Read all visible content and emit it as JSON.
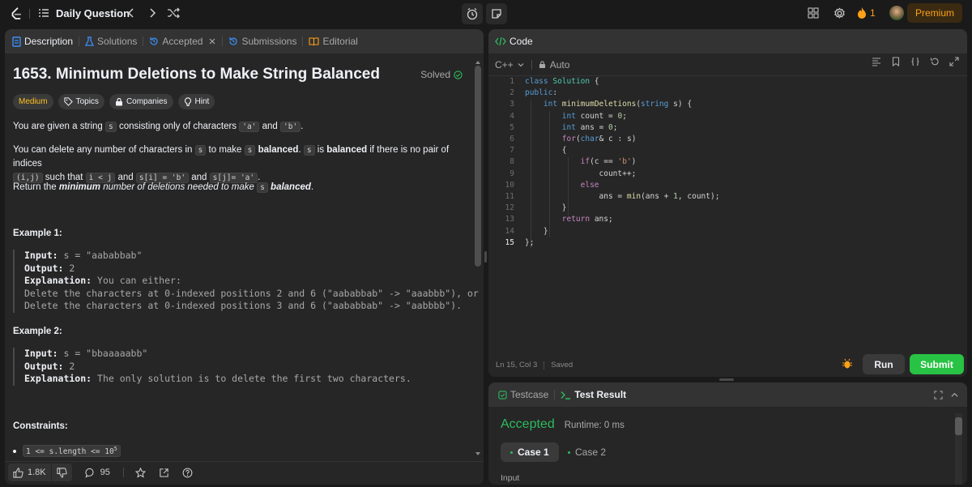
{
  "nav": {
    "title": "Daily Question",
    "streak": "1",
    "premium": "Premium"
  },
  "left_tabs": [
    "Description",
    "Solutions",
    "Accepted",
    "Submissions",
    "Editorial"
  ],
  "problem": {
    "title": "1653. Minimum Deletions to Make String Balanced",
    "status": "Solved",
    "difficulty": "Medium",
    "tags": [
      "Topics",
      "Companies",
      "Hint"
    ],
    "p1": {
      "a": "You are given a string ",
      "c1": "s",
      "b": " consisting only of characters ",
      "c2": "'a'",
      "d": " and ",
      "c3": "'b'",
      "e": "."
    },
    "p2": {
      "a": "You can delete any number of characters in ",
      "c1": "s",
      "b": " to make ",
      "c2": "s",
      "bold1": "balanced",
      "c": ". ",
      "c3": "s",
      "d": " is ",
      "bold2": "balanced",
      "e": " if there is no pair of indices",
      "c4": "(i,j)",
      "f": " such that ",
      "c5": "i < j",
      "g": " and ",
      "c6": "s[i] = 'b'",
      "h": " and ",
      "c7": "s[j]= 'a'",
      "i": "."
    },
    "p3": {
      "a": "Return the ",
      "bold": "minimum",
      "b": " number of deletions needed to make ",
      "c1": "s",
      "bold2": "balanced",
      "c": "."
    },
    "ex1_title": "Example 1:",
    "ex1": {
      "input_k": "Input:",
      "input": " s = \"aababbab\"",
      "output_k": "Output:",
      "output": " 2",
      "expl_k": "Explanation:",
      "expl": " You can either:",
      "l1": "Delete the characters at 0-indexed positions 2 and 6 (\"aababbab\" -> \"aaabbb\"), or",
      "l2": "Delete the characters at 0-indexed positions 3 and 6 (\"aababbab\" -> \"aabbbb\")."
    },
    "ex2_title": "Example 2:",
    "ex2": {
      "input_k": "Input:",
      "input": " s = \"bbaaaaabb\"",
      "output_k": "Output:",
      "output": " 2",
      "expl_k": "Explanation:",
      "expl": " The only solution is to delete the first two characters."
    },
    "constraints_title": "Constraints:",
    "constraint1": "1 <= s.length <= 10",
    "constraint1_sup": "5",
    "likes": "1.8K",
    "comments": "95"
  },
  "editor": {
    "title": "Code",
    "lang": "C++",
    "mode": "Auto",
    "status": "Ln 15, Col 3",
    "saved": "Saved",
    "run": "Run",
    "submit": "Submit"
  },
  "code_lines": [
    {
      "n": "1",
      "t": "class Solution {"
    },
    {
      "n": "2",
      "t": "public:"
    },
    {
      "n": "3",
      "t": "    int minimumDeletions(string s) {"
    },
    {
      "n": "4",
      "t": "        int count = 0;"
    },
    {
      "n": "5",
      "t": "        int ans = 0;"
    },
    {
      "n": "6",
      "t": "        for(char& c : s)"
    },
    {
      "n": "7",
      "t": "        {"
    },
    {
      "n": "8",
      "t": "            if(c == 'b')"
    },
    {
      "n": "9",
      "t": "                count++;"
    },
    {
      "n": "10",
      "t": "            else"
    },
    {
      "n": "11",
      "t": "                ans = min(ans + 1, count);"
    },
    {
      "n": "12",
      "t": "        }"
    },
    {
      "n": "13",
      "t": "        return ans;"
    },
    {
      "n": "14",
      "t": "    }"
    },
    {
      "n": "15",
      "t": "};"
    }
  ],
  "result": {
    "tab1": "Testcase",
    "tab2": "Test Result",
    "verdict": "Accepted",
    "runtime": "Runtime: 0 ms",
    "case1": "Case 1",
    "case2": "Case 2",
    "input_label": "Input"
  },
  "colors": {
    "accent": "#ffa116",
    "success": "#2cbb5d",
    "submit": "#28c244",
    "blue": "#3e8ef7"
  }
}
